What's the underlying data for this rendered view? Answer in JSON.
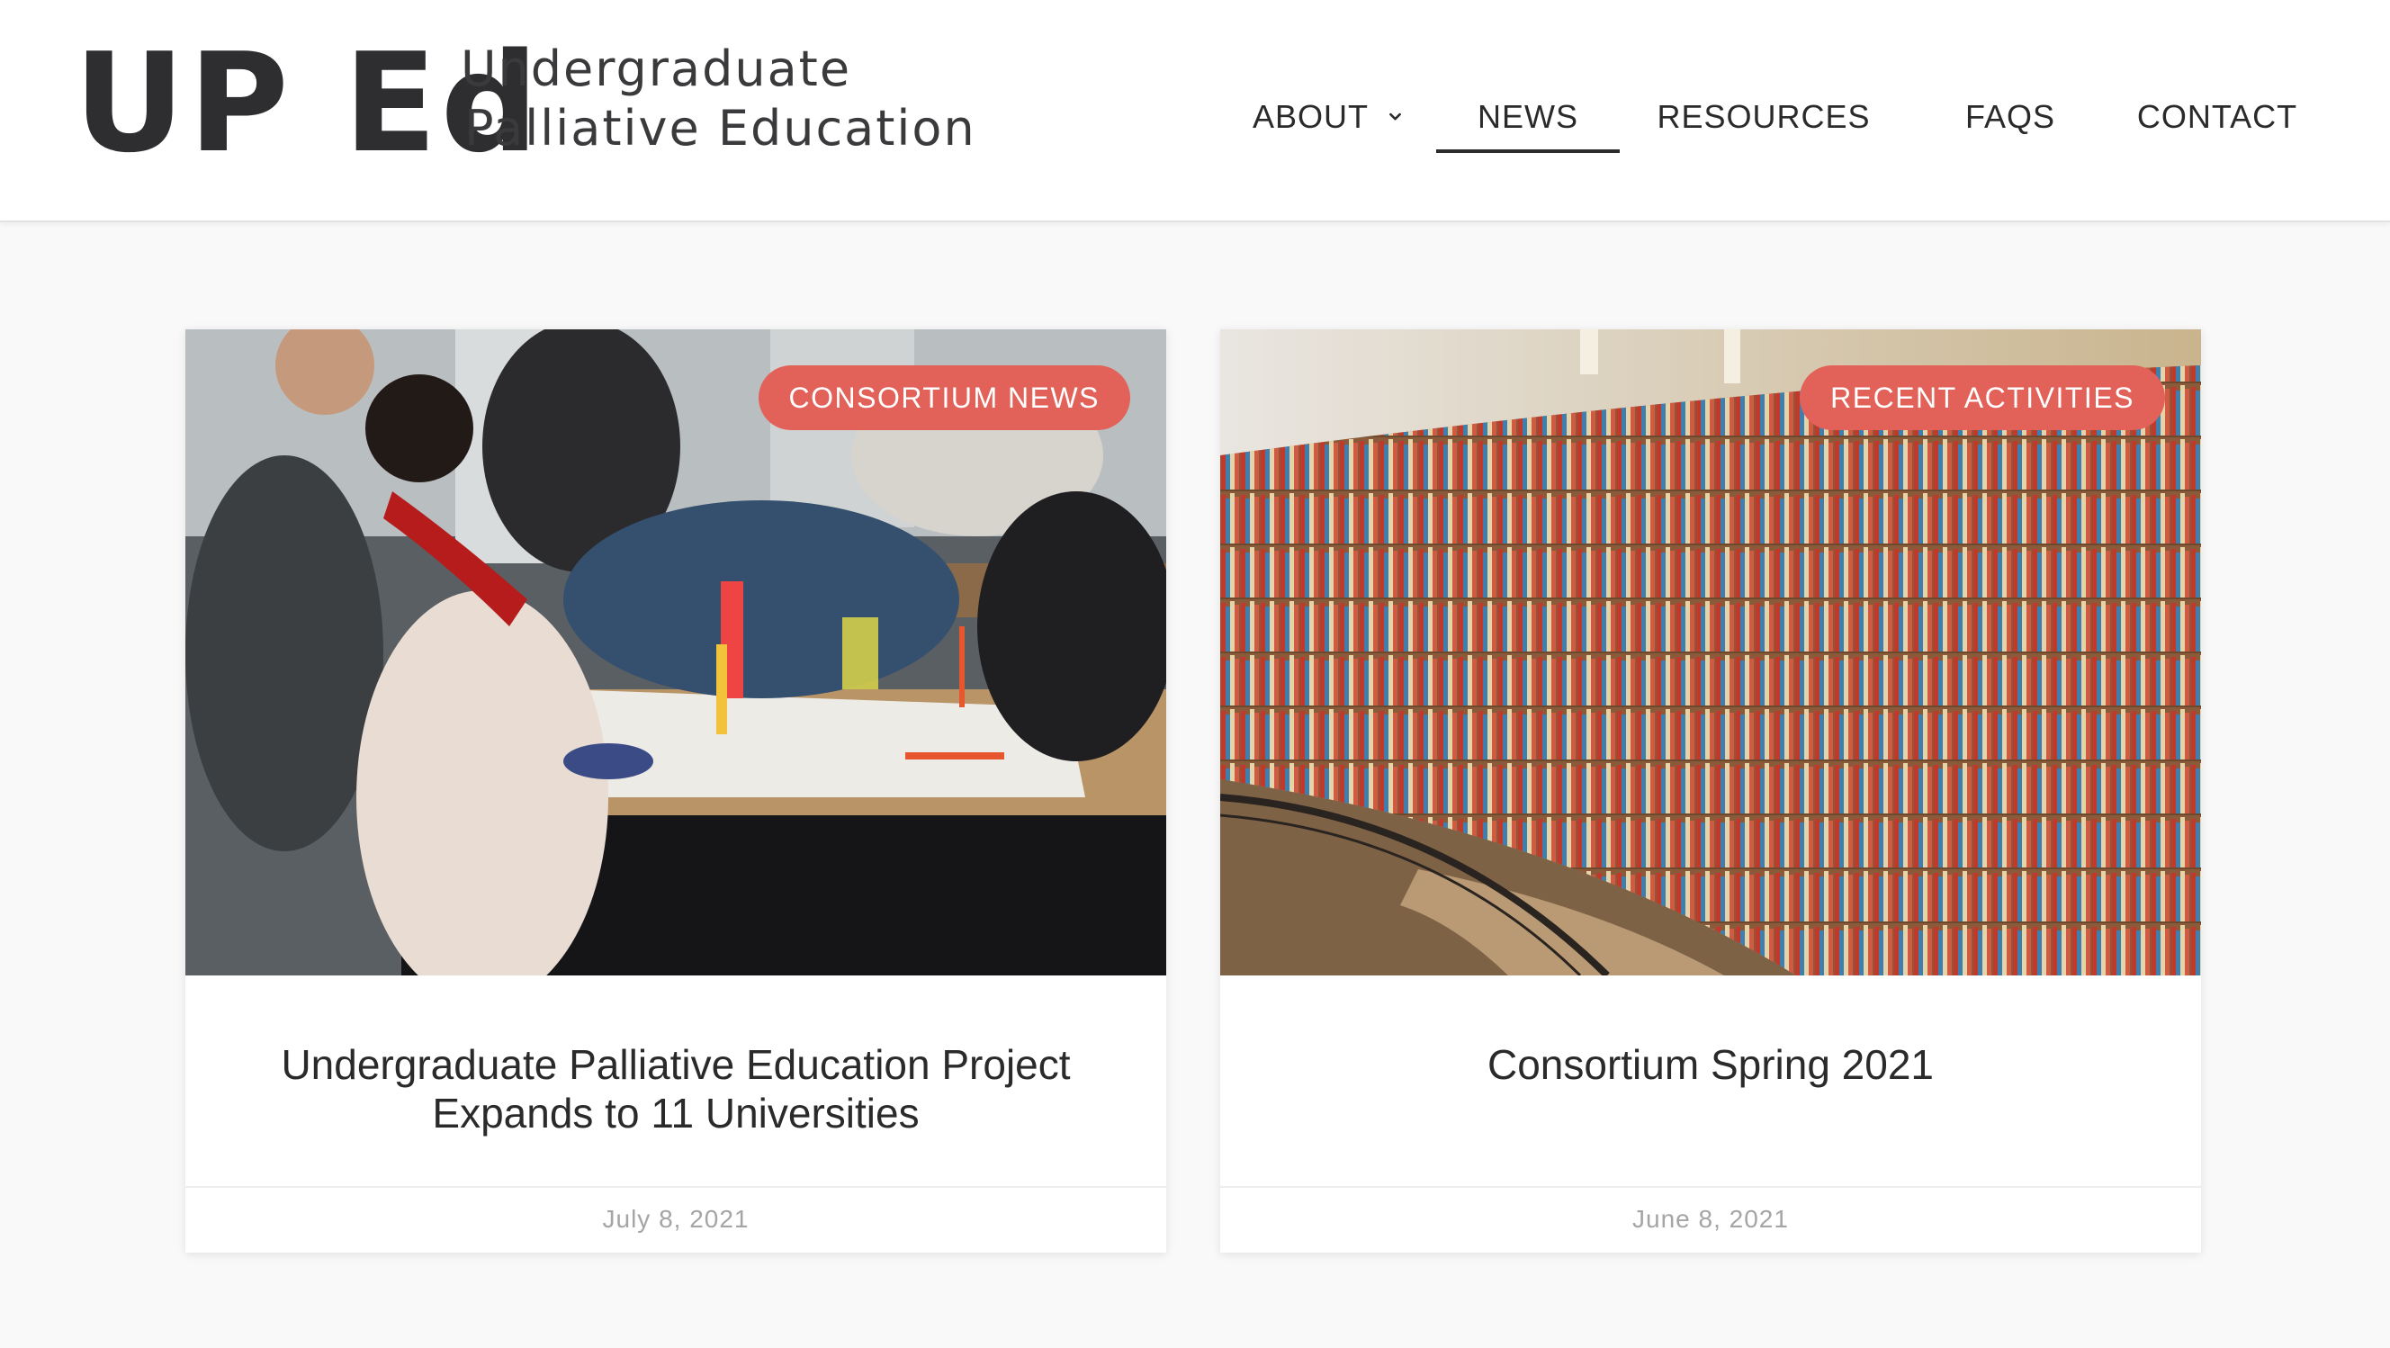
{
  "brand": {
    "mark": "UP Ed",
    "line1": "Undergraduate",
    "line2": "Palliative Education"
  },
  "nav": {
    "items": [
      {
        "label": "ABOUT",
        "has_dropdown": true,
        "active": false
      },
      {
        "label": "NEWS",
        "has_dropdown": false,
        "active": true
      },
      {
        "label": "RESOURCES",
        "has_dropdown": true,
        "active": false
      },
      {
        "label": "FAQS",
        "has_dropdown": false,
        "active": false
      },
      {
        "label": "CONTACT",
        "has_dropdown": false,
        "active": false
      }
    ]
  },
  "posts": [
    {
      "category": "CONSORTIUM NEWS",
      "title": "Undergraduate Palliative Education Project Expands to 11 Universities",
      "date": "July 8, 2021"
    },
    {
      "category": "RECENT ACTIVITIES",
      "title": "Consortium Spring 2021",
      "date": "June 8, 2021"
    }
  ],
  "colors": {
    "badge": "#e2625a",
    "text": "#2b2b2b",
    "date": "#a5a5a5",
    "background": "#f9f9f9"
  }
}
